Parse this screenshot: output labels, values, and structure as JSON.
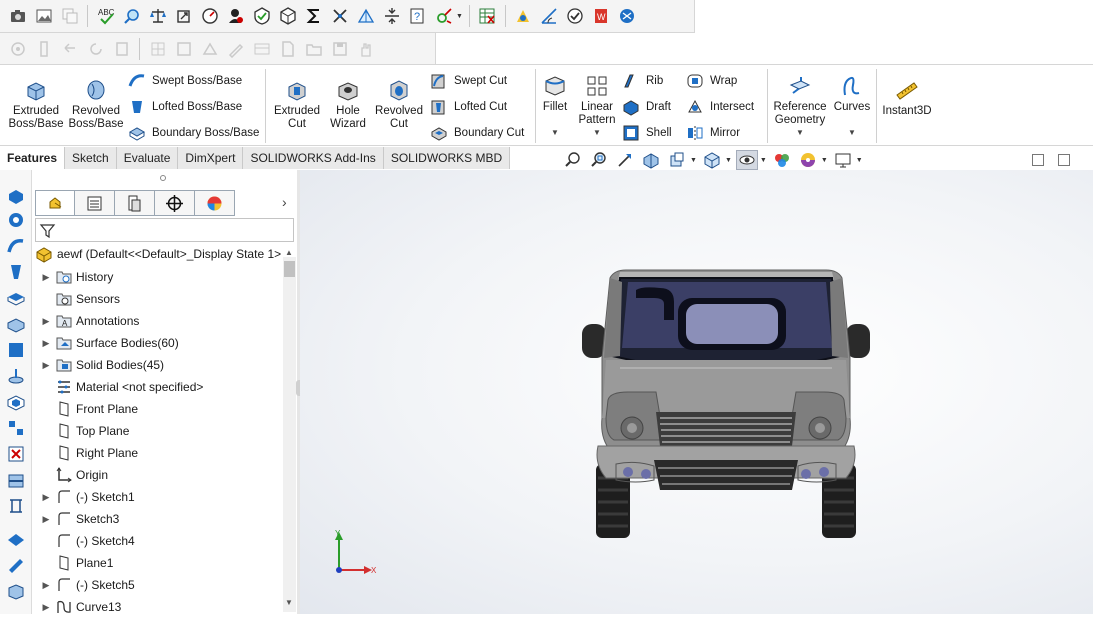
{
  "toolbar_top": {
    "icons": [
      "camera-icon",
      "gallery-icon",
      "copy-icon",
      "spell-check-icon",
      "zoom-search-icon",
      "balance-icon",
      "rotate-icon",
      "gauge-icon",
      "shield-check-icon",
      "box-icon",
      "cube-icon",
      "sum-icon",
      "cross-arrows-icon",
      "fold-icon",
      "compress-icon",
      "query-icon",
      "tool-icon",
      "spreadsheet-icon",
      "color-icon",
      "angle-icon",
      "checkmark-icon",
      "office-icon",
      "globe-icon"
    ]
  },
  "ribbon": {
    "extruded_boss": "Extruded\nBoss/Base",
    "extruded_boss_l1": "Extruded",
    "extruded_boss_l2": "Boss/Base",
    "revolved_boss_l1": "Revolved",
    "revolved_boss_l2": "Boss/Base",
    "swept_boss": "Swept Boss/Base",
    "lofted_boss": "Lofted Boss/Base",
    "boundary_boss": "Boundary Boss/Base",
    "extruded_cut_l1": "Extruded",
    "extruded_cut_l2": "Cut",
    "hole_wizard_l1": "Hole",
    "hole_wizard_l2": "Wizard",
    "revolved_cut_l1": "Revolved",
    "revolved_cut_l2": "Cut",
    "swept_cut": "Swept Cut",
    "lofted_cut": "Lofted Cut",
    "boundary_cut": "Boundary Cut",
    "fillet": "Fillet",
    "linear_pattern_l1": "Linear",
    "linear_pattern_l2": "Pattern",
    "rib": "Rib",
    "draft": "Draft",
    "shell": "Shell",
    "wrap": "Wrap",
    "intersect": "Intersect",
    "mirror": "Mirror",
    "reference_geometry_l1": "Reference",
    "reference_geometry_l2": "Geometry",
    "curves": "Curves",
    "instant3d": "Instant3D"
  },
  "tabs": [
    {
      "label": "Features",
      "active": true
    },
    {
      "label": "Sketch"
    },
    {
      "label": "Evaluate"
    },
    {
      "label": "DimXpert"
    },
    {
      "label": "SOLIDWORKS Add-Ins"
    },
    {
      "label": "SOLIDWORKS MBD"
    }
  ],
  "feature_tree": {
    "root": "aewf  (Default<<Default>_Display State 1>",
    "items": [
      {
        "label": "History",
        "icon": "history-folder-icon",
        "expandable": true
      },
      {
        "label": "Sensors",
        "icon": "sensor-icon",
        "expandable": false
      },
      {
        "label": "Annotations",
        "icon": "annotation-icon",
        "expandable": true
      },
      {
        "label": "Surface Bodies(60)",
        "icon": "surface-bodies-icon",
        "expandable": true
      },
      {
        "label": "Solid Bodies(45)",
        "icon": "solid-bodies-icon",
        "expandable": true
      },
      {
        "label": "Material <not specified>",
        "icon": "material-icon",
        "expandable": false
      },
      {
        "label": "Front Plane",
        "icon": "plane-icon",
        "expandable": false
      },
      {
        "label": "Top Plane",
        "icon": "plane-icon",
        "expandable": false
      },
      {
        "label": "Right Plane",
        "icon": "plane-icon",
        "expandable": false
      },
      {
        "label": "Origin",
        "icon": "origin-icon",
        "expandable": false
      },
      {
        "label": "(-) Sketch1",
        "icon": "sketch-icon",
        "expandable": true
      },
      {
        "label": "Sketch3",
        "icon": "sketch-icon",
        "expandable": true
      },
      {
        "label": "(-) Sketch4",
        "icon": "sketch-icon",
        "expandable": false
      },
      {
        "label": "Plane1",
        "icon": "plane-icon",
        "expandable": false
      },
      {
        "label": "(-) Sketch5",
        "icon": "sketch-icon",
        "expandable": true
      },
      {
        "label": "Curve13",
        "icon": "curve-icon",
        "expandable": true
      }
    ]
  },
  "triad": {
    "x_label": "X",
    "y_label": "Y"
  },
  "colors": {
    "accent_blue": "#1f6fc5",
    "ribbon_bg": "#ffffff",
    "toolbar_bg": "#f4f4f4",
    "truck_body": "#8e8e8e"
  }
}
